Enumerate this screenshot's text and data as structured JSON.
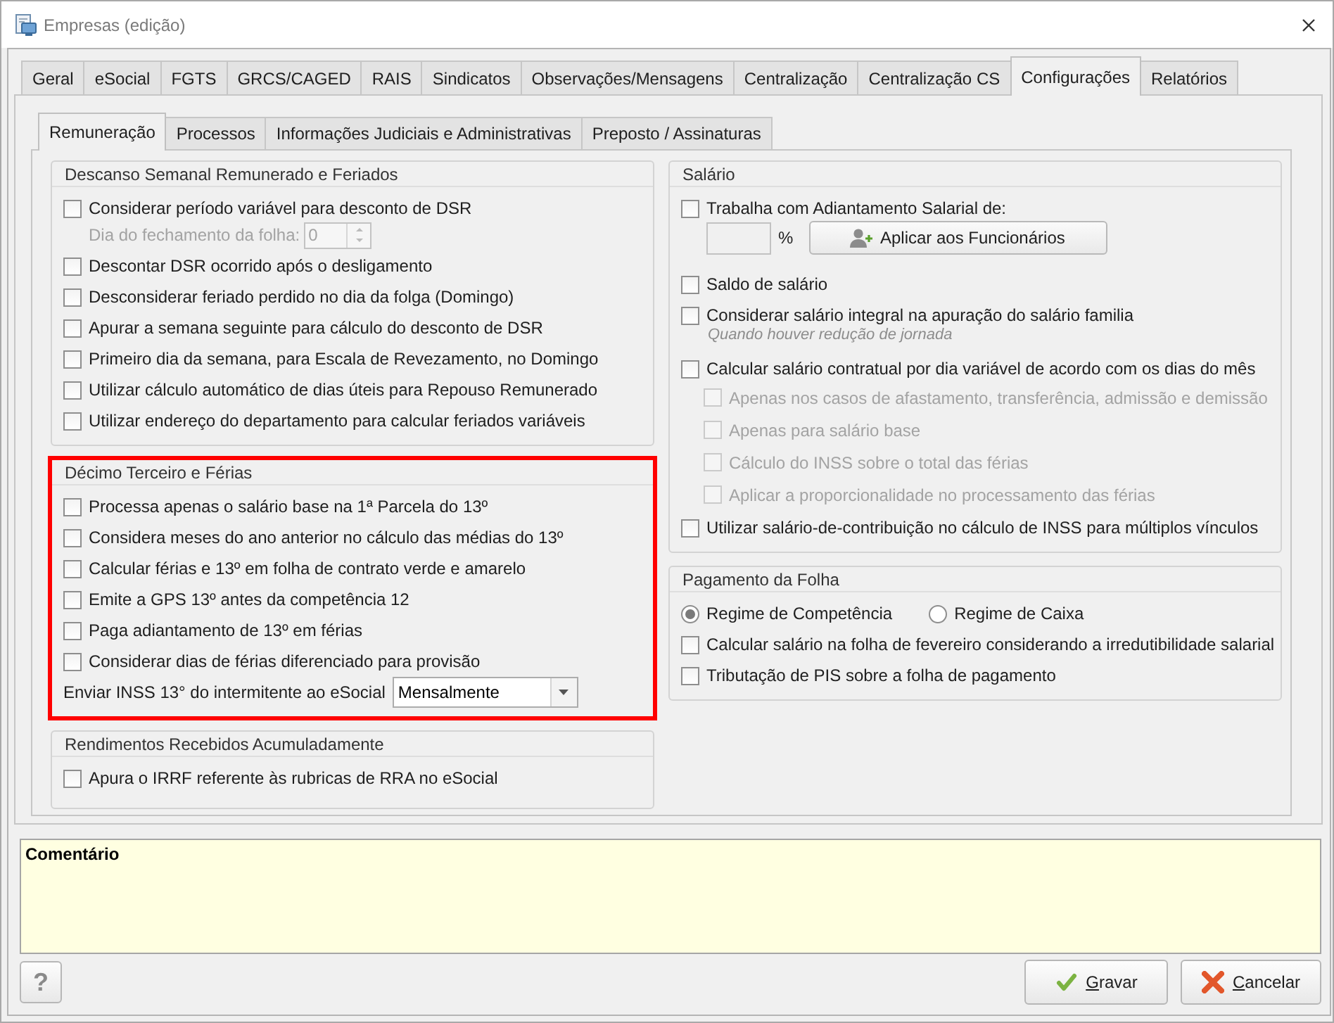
{
  "window": {
    "title": "Empresas (edição)"
  },
  "tabs": [
    {
      "label": "Geral",
      "selected": false
    },
    {
      "label": "eSocial",
      "selected": false
    },
    {
      "label": "FGTS",
      "selected": false
    },
    {
      "label": "GRCS/CAGED",
      "selected": false
    },
    {
      "label": "RAIS",
      "selected": false
    },
    {
      "label": "Sindicatos",
      "selected": false
    },
    {
      "label": "Observações/Mensagens",
      "selected": false
    },
    {
      "label": "Centralização",
      "selected": false
    },
    {
      "label": "Centralização CS",
      "selected": false
    },
    {
      "label": "Configurações",
      "selected": true
    },
    {
      "label": "Relatórios",
      "selected": false
    }
  ],
  "subtabs": [
    {
      "label": "Remuneração",
      "selected": true
    },
    {
      "label": "Processos",
      "selected": false
    },
    {
      "label": "Informações Judiciais e Administrativas",
      "selected": false
    },
    {
      "label": "Preposto / Assinaturas",
      "selected": false
    }
  ],
  "columns": [
    {
      "groups": [
        {
          "title": "Descanso Semanal Remunerado e Feriados",
          "highlighted": false,
          "items": [
            {
              "kind": "checkbox",
              "label": "Considerar período variável para desconto de DSR",
              "checked": false,
              "children": [
                {
                  "kind": "spin",
                  "label": "Dia do fechamento da folha:",
                  "value": "0",
                  "disabled": true
                }
              ]
            },
            {
              "kind": "checkbox",
              "label": "Descontar DSR ocorrido após o desligamento",
              "checked": false
            },
            {
              "kind": "checkbox",
              "label": "Desconsiderar feriado perdido no dia da folga (Domingo)",
              "checked": false
            },
            {
              "kind": "checkbox",
              "label": "Apurar a semana seguinte para cálculo do desconto de DSR",
              "checked": false
            },
            {
              "kind": "checkbox",
              "label": "Primeiro dia da semana, para Escala de Revezamento, no Domingo",
              "checked": false
            },
            {
              "kind": "checkbox",
              "label": "Utilizar cálculo automático de dias úteis para Repouso Remunerado",
              "checked": false
            },
            {
              "kind": "checkbox",
              "label": "Utilizar endereço do departamento para calcular feriados variáveis",
              "checked": false
            }
          ]
        },
        {
          "title": "Décimo Terceiro e Férias",
          "highlighted": true,
          "items": [
            {
              "kind": "checkbox",
              "label": "Processa apenas o salário base na 1ª Parcela do 13º",
              "checked": false
            },
            {
              "kind": "checkbox",
              "label": "Considera meses do ano anterior no cálculo das médias do 13º",
              "checked": false
            },
            {
              "kind": "checkbox",
              "label": "Calcular férias e 13º em folha de contrato verde e amarelo",
              "checked": false
            },
            {
              "kind": "checkbox",
              "label": "Emite a GPS 13º antes da competência 12",
              "checked": false
            },
            {
              "kind": "checkbox",
              "label": "Paga adiantamento de 13º em férias",
              "checked": false
            },
            {
              "kind": "checkbox",
              "label": "Considerar dias de férias diferenciado para provisão",
              "checked": false
            },
            {
              "kind": "select",
              "label": "Enviar INSS 13° do intermitente ao eSocial",
              "value": "Mensalmente"
            }
          ]
        },
        {
          "title": "Rendimentos Recebidos Acumuladamente",
          "highlighted": false,
          "items": [
            {
              "kind": "checkbox",
              "label": "Apura o IRRF referente às rubricas de RRA no eSocial",
              "checked": false
            }
          ]
        }
      ]
    },
    {
      "groups": [
        {
          "title": "Salário",
          "highlighted": false,
          "items": [
            {
              "kind": "checkbox",
              "label": "Trabalha com Adiantamento Salarial de:",
              "checked": false,
              "children": [
                {
                  "kind": "amount",
                  "unit": "%",
                  "button": "Aplicar aos Funcionários"
                }
              ]
            },
            {
              "kind": "checkbox",
              "label": "Saldo de salário",
              "checked": false
            },
            {
              "kind": "checkbox",
              "label": "Considerar salário integral na apuração do salário familia",
              "checked": false,
              "hint": "Quando houver redução de jornada"
            },
            {
              "kind": "checkbox",
              "label": "Calcular salário contratual por dia variável de acordo com os dias do mês",
              "checked": false,
              "children": [
                {
                  "kind": "checkbox",
                  "label": "Apenas nos casos de afastamento, transferência, admissão e demissão",
                  "checked": false,
                  "disabled": true
                },
                {
                  "kind": "checkbox",
                  "label": "Apenas para salário base",
                  "checked": false,
                  "disabled": true
                },
                {
                  "kind": "checkbox",
                  "label": "Cálculo do INSS sobre o total das férias",
                  "checked": false,
                  "disabled": true
                },
                {
                  "kind": "checkbox",
                  "label": "Aplicar a proporcionalidade no processamento das férias",
                  "checked": false,
                  "disabled": true
                }
              ]
            },
            {
              "kind": "checkbox",
              "label": "Utilizar salário-de-contribuição no cálculo de INSS para múltiplos vínculos",
              "checked": false
            }
          ]
        },
        {
          "title": "Pagamento da Folha",
          "highlighted": false,
          "items": [
            {
              "kind": "radio",
              "options": [
                {
                  "label": "Regime de Competência",
                  "selected": true
                },
                {
                  "label": "Regime de Caixa",
                  "selected": false
                }
              ]
            },
            {
              "kind": "checkbox",
              "label": "Calcular salário na folha de fevereiro considerando a irredutibilidade salarial",
              "checked": false
            },
            {
              "kind": "checkbox",
              "label": "Tributação de PIS sobre a folha de pagamento",
              "checked": false
            }
          ]
        }
      ]
    }
  ],
  "comment": {
    "label": "Comentário"
  },
  "help_button": {
    "label": "?"
  },
  "buttons": [
    {
      "kind": "save",
      "label": "Gravar",
      "underline_first": true
    },
    {
      "kind": "cancel",
      "label": "Cancelar",
      "underline_first": true
    }
  ]
}
